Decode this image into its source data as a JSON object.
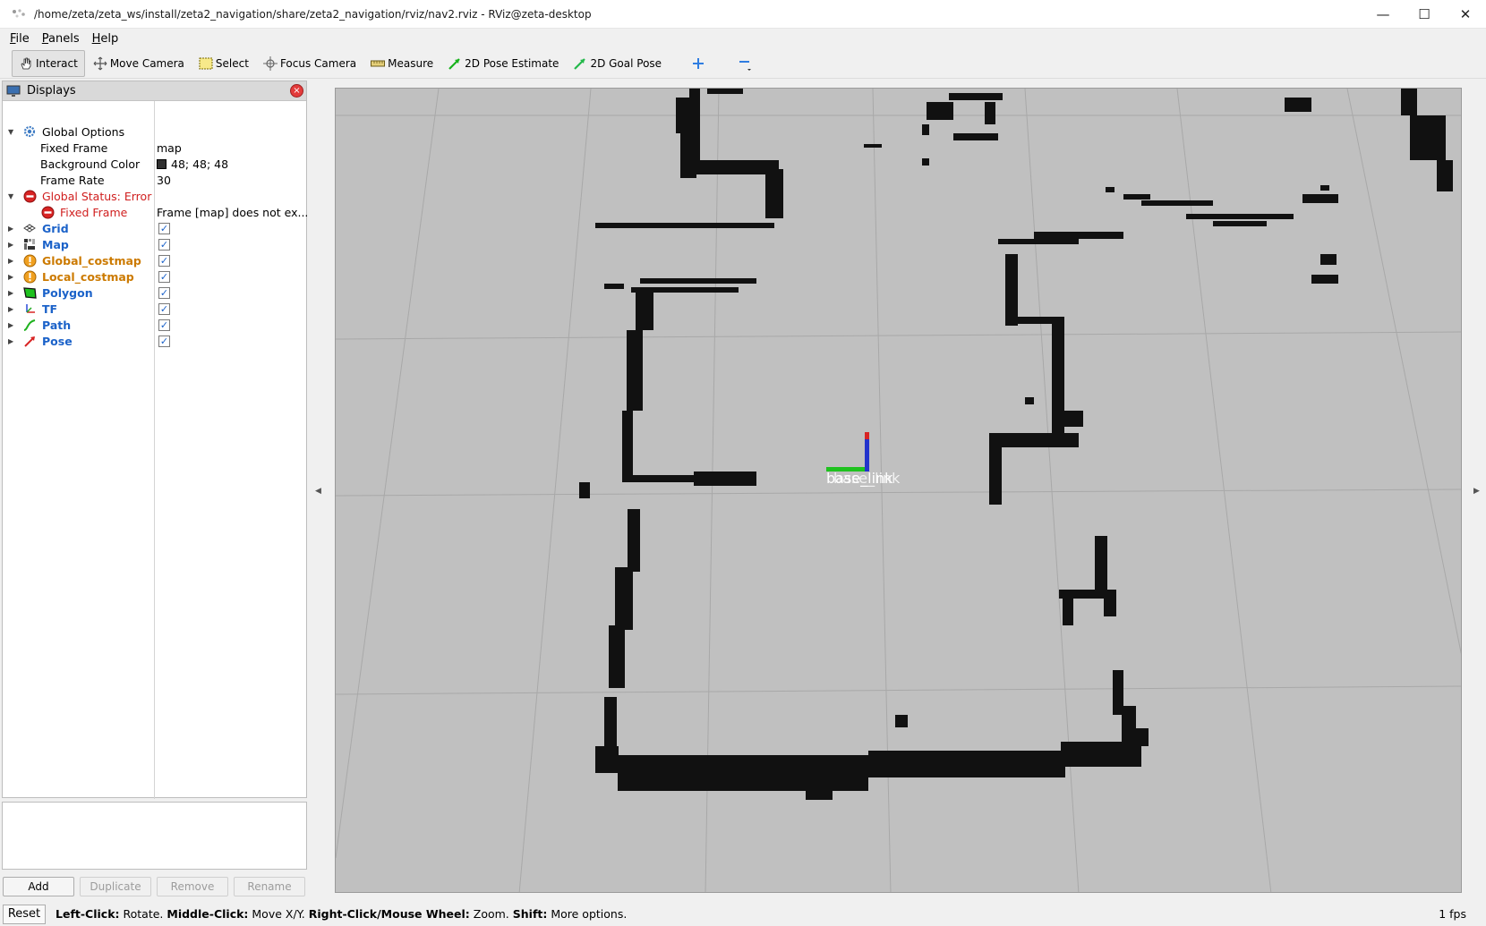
{
  "window": {
    "title": "/home/zeta/zeta_ws/install/zeta2_navigation/share/zeta2_navigation/rviz/nav2.rviz - RViz@zeta-desktop",
    "minimize": "—",
    "maximize": "☐",
    "close": "✕"
  },
  "menu": [
    "File",
    "Panels",
    "Help"
  ],
  "toolbar": {
    "interact": "Interact",
    "move_camera": "Move Camera",
    "select": "Select",
    "focus_camera": "Focus Camera",
    "measure": "Measure",
    "pose_estimate": "2D Pose Estimate",
    "goal_pose": "2D Goal Pose"
  },
  "displays": {
    "title": "Displays",
    "global_options": "Global Options",
    "fixed_frame_label": "Fixed Frame",
    "fixed_frame_value": "map",
    "background_color_label": "Background Color",
    "background_color_value": "48; 48; 48",
    "background_color_hex": "#303030",
    "frame_rate_label": "Frame Rate",
    "frame_rate_value": "30",
    "global_status": "Global Status: Error",
    "status_fixed_frame": "Fixed Frame",
    "status_fixed_frame_msg": "Frame [map] does not ex...",
    "items": [
      {
        "name": "Grid",
        "checked": true,
        "status": "ok"
      },
      {
        "name": "Map",
        "checked": true,
        "status": "ok"
      },
      {
        "name": "Global_costmap",
        "checked": true,
        "status": "warn"
      },
      {
        "name": "Local_costmap",
        "checked": true,
        "status": "warn"
      },
      {
        "name": "Polygon",
        "checked": true,
        "status": "ok"
      },
      {
        "name": "TF",
        "checked": true,
        "status": "ok"
      },
      {
        "name": "Path",
        "checked": true,
        "status": "ok"
      },
      {
        "name": "Pose",
        "checked": true,
        "status": "ok"
      }
    ]
  },
  "buttons": {
    "add": "Add",
    "duplicate": "Duplicate",
    "remove": "Remove",
    "rename": "Rename"
  },
  "view": {
    "tf_label": "base_link"
  },
  "status": {
    "reset": "Reset",
    "left_click_key": "Left-Click:",
    "left_click_val": " Rotate. ",
    "middle_click_key": "Middle-Click:",
    "middle_click_val": " Move X/Y. ",
    "right_click_key": "Right-Click/Mouse Wheel:",
    "right_click_val": " Zoom. ",
    "shift_key": "Shift:",
    "shift_val": " More options.",
    "fps": "1 fps"
  },
  "colors": {
    "view_bg": "#c0c0c0",
    "obstacle": "#111111",
    "error": "#d01e1e",
    "warning": "#cc7a00",
    "display_name": "#1b62c9"
  }
}
